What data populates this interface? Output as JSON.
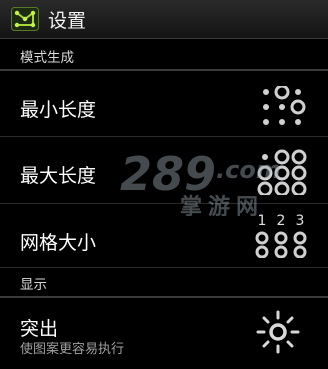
{
  "header": {
    "title": "设置",
    "app_icon": "pattern-lock-icon"
  },
  "sections": [
    {
      "label": "模式生成",
      "items": [
        {
          "title": "最小长度",
          "icon": "min-length-dots-icon"
        },
        {
          "title": "最大长度",
          "icon": "max-length-dots-icon"
        },
        {
          "title": "网格大小",
          "icon": "grid-size-icon",
          "grid_numbers": [
            "1",
            "2",
            "3"
          ]
        }
      ]
    },
    {
      "label": "显示",
      "items": [
        {
          "title": "突出",
          "summary": "使图案更容易执行",
          "icon": "highlight-sun-icon"
        }
      ]
    }
  ],
  "watermark": {
    "text_main": "289",
    "text_domain": ".com",
    "text_cn": "掌游网"
  },
  "colors": {
    "background": "#000000",
    "divider": "#3a3a3a",
    "dot": "#d0d0d0",
    "watermark": "#9aa3ad"
  }
}
